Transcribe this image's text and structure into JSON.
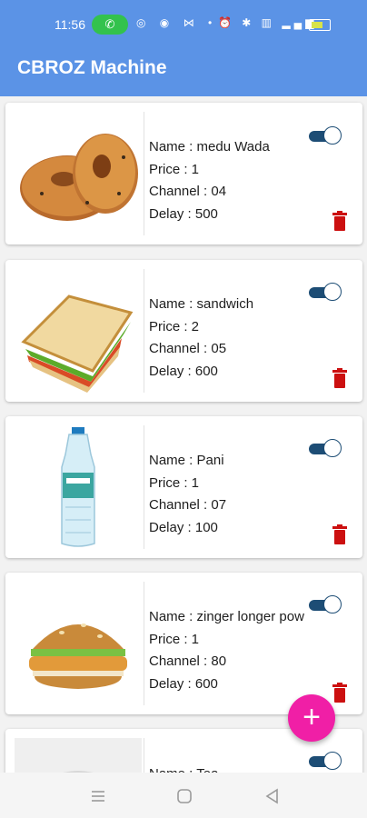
{
  "status_bar": {
    "time": "11:56",
    "battery_label": "74"
  },
  "app_bar": {
    "title": "CBROZ Machine"
  },
  "items": [
    {
      "name_line": "Name : medu Wada",
      "price_line": "Price : 1",
      "channel_line": "Channel : 04",
      "delay_line": "Delay : 500",
      "image": "medu-wada-image",
      "enabled": true
    },
    {
      "name_line": "Name : sandwich",
      "price_line": "Price : 2",
      "channel_line": "Channel : 05",
      "delay_line": "Delay : 600",
      "image": "sandwich-image",
      "enabled": true
    },
    {
      "name_line": "Name : Pani",
      "price_line": "Price : 1",
      "channel_line": "Channel : 07",
      "delay_line": "Delay : 100",
      "image": "water-bottle-image",
      "enabled": true
    },
    {
      "name_line": "Name : zinger longer pow",
      "price_line": "Price : 1",
      "channel_line": "Channel : 80",
      "delay_line": "Delay : 600",
      "image": "burger-image",
      "enabled": true
    },
    {
      "name_line": "Name : Tea",
      "image": "tea-cup-image",
      "enabled": true
    }
  ],
  "fab": {
    "label": "+",
    "icon": "add-icon",
    "color": "#f01fa6"
  },
  "colors": {
    "app_bar": "#5b93e6",
    "toggle": "#1d4d75",
    "delete_icon": "#cc1010"
  },
  "nav": {
    "icons": [
      "menu-icon",
      "home-icon",
      "back-icon"
    ]
  }
}
